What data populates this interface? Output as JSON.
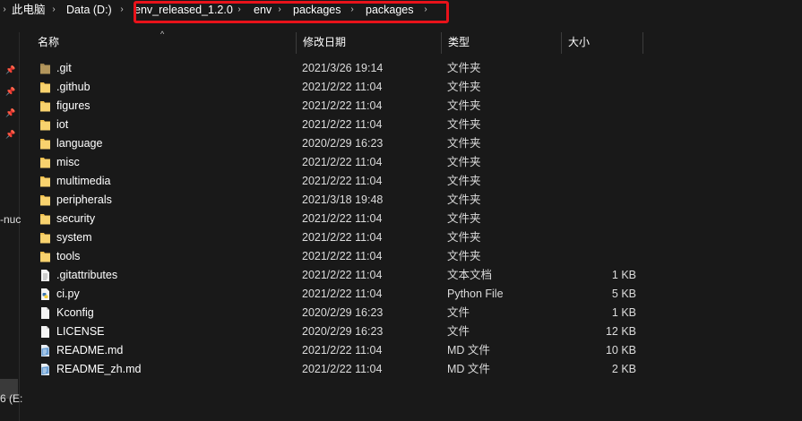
{
  "breadcrumb": {
    "items": [
      "此电脑",
      "Data (D:)",
      "env_released_1.2.0",
      "env",
      "packages",
      "packages"
    ]
  },
  "nav": {
    "labels": [
      "-nuc",
      "6 (E:"
    ]
  },
  "columns": {
    "name": "名称",
    "modified": "修改日期",
    "type": "类型",
    "size": "大小"
  },
  "files": [
    {
      "name": ".git",
      "modified": "2021/3/26 19:14",
      "type": "文件夹",
      "size": "",
      "icon": "git-folder-icon"
    },
    {
      "name": ".github",
      "modified": "2021/2/22 11:04",
      "type": "文件夹",
      "size": "",
      "icon": "folder-icon"
    },
    {
      "name": "figures",
      "modified": "2021/2/22 11:04",
      "type": "文件夹",
      "size": "",
      "icon": "folder-icon"
    },
    {
      "name": "iot",
      "modified": "2021/2/22 11:04",
      "type": "文件夹",
      "size": "",
      "icon": "folder-icon"
    },
    {
      "name": "language",
      "modified": "2020/2/29 16:23",
      "type": "文件夹",
      "size": "",
      "icon": "folder-icon"
    },
    {
      "name": "misc",
      "modified": "2021/2/22 11:04",
      "type": "文件夹",
      "size": "",
      "icon": "folder-icon"
    },
    {
      "name": "multimedia",
      "modified": "2021/2/22 11:04",
      "type": "文件夹",
      "size": "",
      "icon": "folder-icon"
    },
    {
      "name": "peripherals",
      "modified": "2021/3/18 19:48",
      "type": "文件夹",
      "size": "",
      "icon": "folder-icon"
    },
    {
      "name": "security",
      "modified": "2021/2/22 11:04",
      "type": "文件夹",
      "size": "",
      "icon": "folder-icon"
    },
    {
      "name": "system",
      "modified": "2021/2/22 11:04",
      "type": "文件夹",
      "size": "",
      "icon": "folder-icon"
    },
    {
      "name": "tools",
      "modified": "2021/2/22 11:04",
      "type": "文件夹",
      "size": "",
      "icon": "folder-icon"
    },
    {
      "name": ".gitattributes",
      "modified": "2021/2/22 11:04",
      "type": "文本文档",
      "size": "1 KB",
      "icon": "text-file-icon"
    },
    {
      "name": "ci.py",
      "modified": "2021/2/22 11:04",
      "type": "Python File",
      "size": "5 KB",
      "icon": "python-file-icon"
    },
    {
      "name": "Kconfig",
      "modified": "2020/2/29 16:23",
      "type": "文件",
      "size": "1 KB",
      "icon": "blank-file-icon"
    },
    {
      "name": "LICENSE",
      "modified": "2020/2/29 16:23",
      "type": "文件",
      "size": "12 KB",
      "icon": "blank-file-icon"
    },
    {
      "name": "README.md",
      "modified": "2021/2/22 11:04",
      "type": "MD 文件",
      "size": "10 KB",
      "icon": "markdown-file-icon"
    },
    {
      "name": "README_zh.md",
      "modified": "2021/2/22 11:04",
      "type": "MD 文件",
      "size": "2 KB",
      "icon": "markdown-file-icon"
    }
  ],
  "colors": {
    "background": "#191919",
    "folder": "#f2c14e",
    "highlight_box": "#e8121a"
  }
}
